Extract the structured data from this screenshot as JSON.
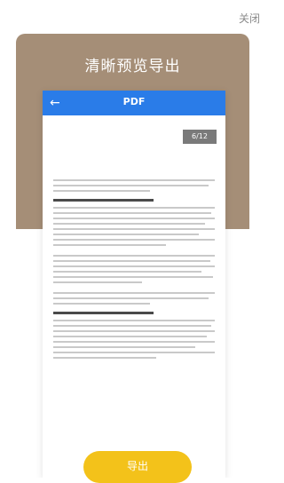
{
  "header": {
    "close_label": "关闭"
  },
  "card": {
    "title": "清晰预览导出"
  },
  "viewer": {
    "title": "PDF",
    "back_icon": "arrow-left-icon",
    "page_indicator": "6/12"
  },
  "footer": {
    "export_label": "导出"
  }
}
